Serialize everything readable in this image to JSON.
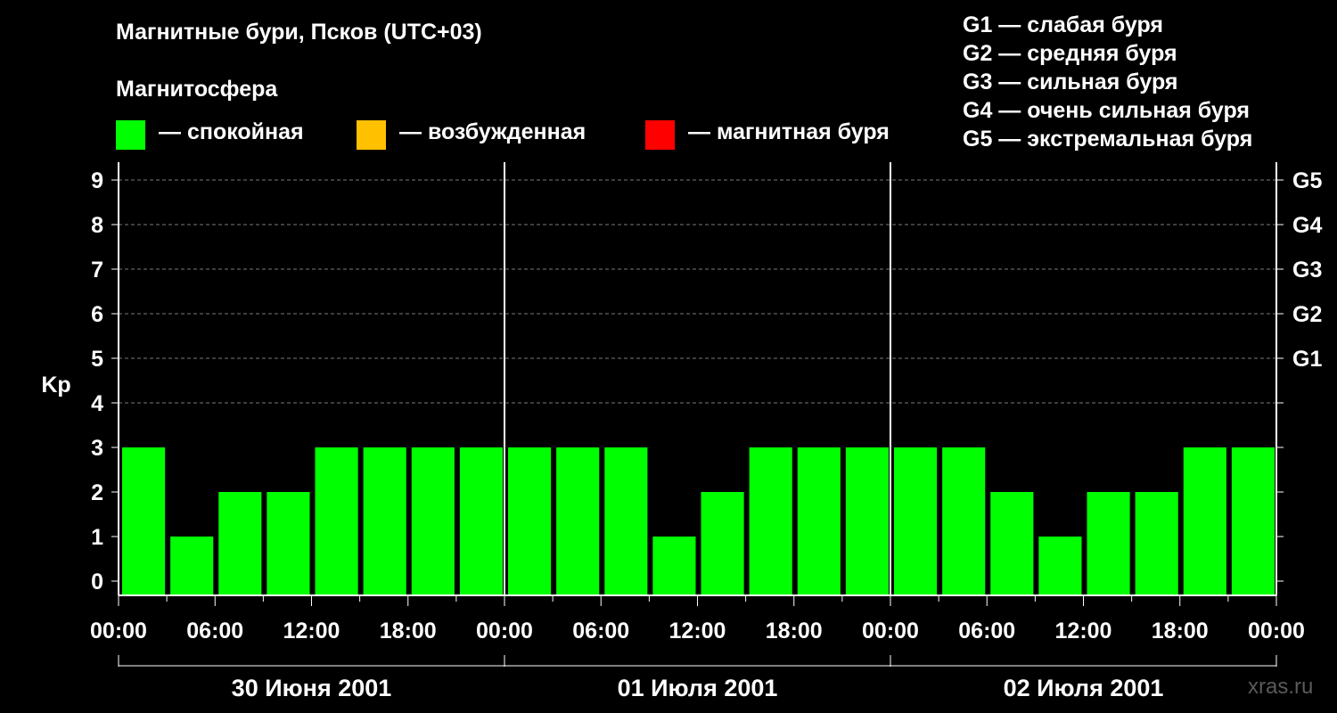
{
  "header": {
    "title": "Магнитные бури, Псков (UTC+03)",
    "subtitle": "Магнитосфера"
  },
  "legend": [
    {
      "label": "— спокойная",
      "color": "#00ff00"
    },
    {
      "label": "— возбужденная",
      "color": "#ffc000"
    },
    {
      "label": "— магнитная буря",
      "color": "#ff0000"
    }
  ],
  "g_levels": [
    "G1 — слабая буря",
    "G2 — средняя буря",
    "G3 — сильная буря",
    "G4 — очень сильная буря",
    "G5 — экстремальная буря"
  ],
  "watermark": "xras.ru",
  "chart_data": {
    "type": "bar",
    "title": "Магнитные бури, Псков (UTC+03)",
    "ylabel": "Kp",
    "ylim": [
      0,
      9
    ],
    "yticks": [
      0,
      1,
      2,
      3,
      4,
      5,
      6,
      7,
      8,
      9
    ],
    "right_axis_labels": [
      {
        "y": 5,
        "label": "G1"
      },
      {
        "y": 6,
        "label": "G2"
      },
      {
        "y": 7,
        "label": "G3"
      },
      {
        "y": 8,
        "label": "G4"
      },
      {
        "y": 9,
        "label": "G5"
      }
    ],
    "grid": true,
    "xtick_labels": [
      "00:00",
      "06:00",
      "12:00",
      "18:00",
      "00:00",
      "06:00",
      "12:00",
      "18:00",
      "00:00",
      "06:00",
      "12:00",
      "18:00",
      "00:00"
    ],
    "days": [
      "30 Июня 2001",
      "01 Июля 2001",
      "02 Июля 2001"
    ],
    "interval_hours": 3,
    "values": [
      3,
      1,
      2,
      2,
      3,
      3,
      3,
      3,
      3,
      3,
      3,
      1,
      2,
      3,
      3,
      3,
      3,
      3,
      2,
      1,
      2,
      2,
      3,
      3
    ],
    "bar_color": "#00ff00"
  }
}
